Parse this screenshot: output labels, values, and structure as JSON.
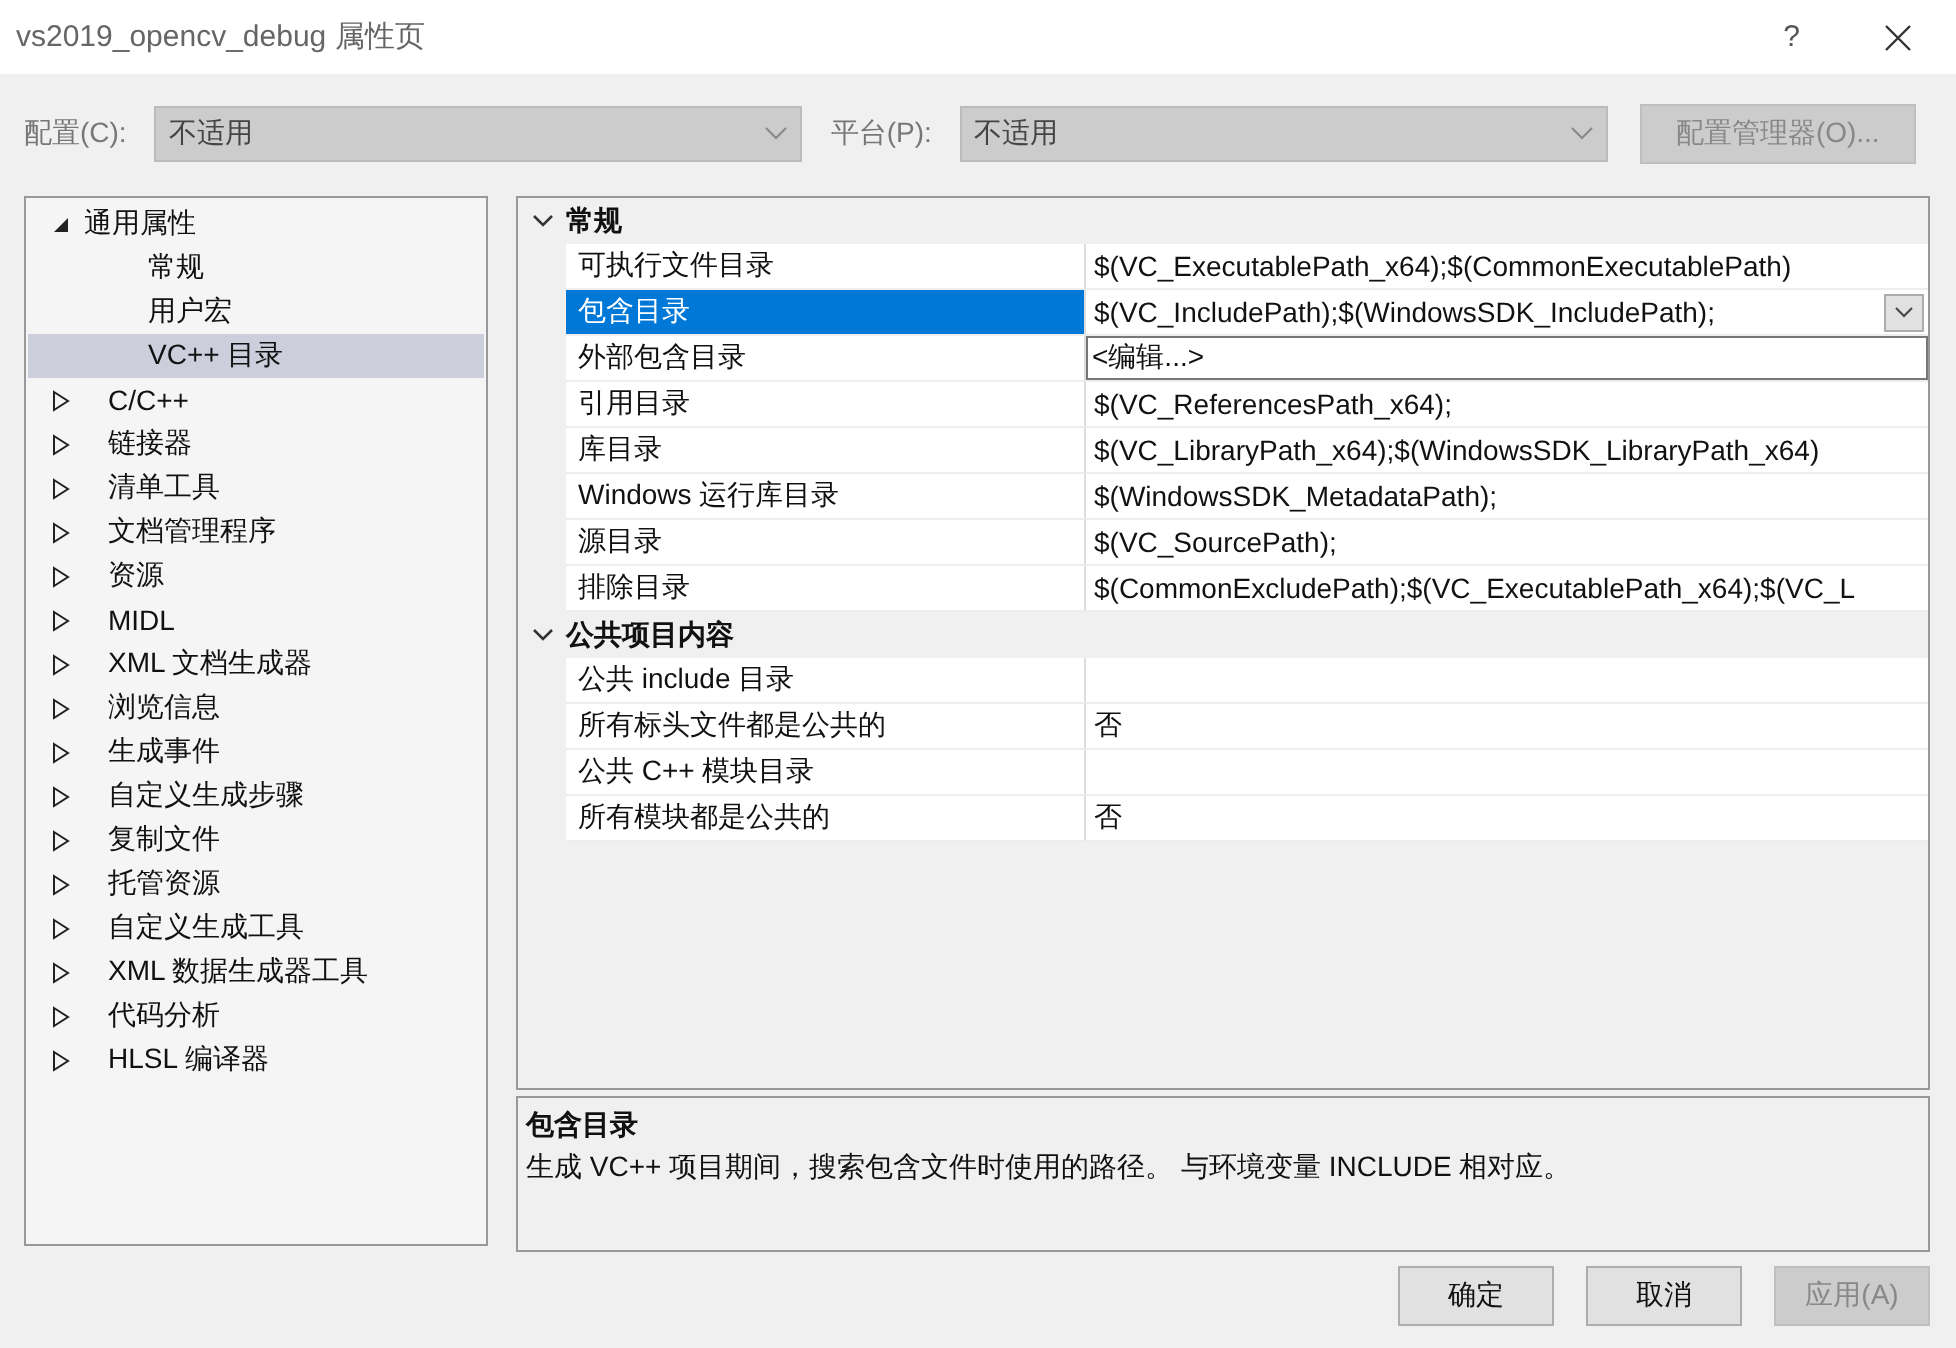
{
  "window": {
    "title": "vs2019_opencv_debug 属性页",
    "help": "?"
  },
  "config": {
    "label": "配置(C):",
    "value": "不适用",
    "disabled": true
  },
  "platform": {
    "label": "平台(P):",
    "value": "不适用",
    "disabled": true
  },
  "config_manager_button": {
    "label": "配置管理器(O)...",
    "disabled": true
  },
  "tree": [
    {
      "label": "通用属性",
      "expanded": true,
      "selected": false,
      "children": [
        {
          "label": "常规",
          "selected": false
        },
        {
          "label": "用户宏",
          "selected": false
        },
        {
          "label": "VC++ 目录",
          "selected": true
        }
      ]
    },
    {
      "label": "C/C++",
      "expanded": false,
      "selected": false
    },
    {
      "label": "链接器",
      "expanded": false,
      "selected": false
    },
    {
      "label": "清单工具",
      "expanded": false,
      "selected": false
    },
    {
      "label": "文档管理程序",
      "expanded": false,
      "selected": false
    },
    {
      "label": "资源",
      "expanded": false,
      "selected": false
    },
    {
      "label": "MIDL",
      "expanded": false,
      "selected": false
    },
    {
      "label": "XML 文档生成器",
      "expanded": false,
      "selected": false
    },
    {
      "label": "浏览信息",
      "expanded": false,
      "selected": false
    },
    {
      "label": "生成事件",
      "expanded": false,
      "selected": false
    },
    {
      "label": "自定义生成步骤",
      "expanded": false,
      "selected": false
    },
    {
      "label": "复制文件",
      "expanded": false,
      "selected": false
    },
    {
      "label": "托管资源",
      "expanded": false,
      "selected": false
    },
    {
      "label": "自定义生成工具",
      "expanded": false,
      "selected": false
    },
    {
      "label": "XML 数据生成器工具",
      "expanded": false,
      "selected": false
    },
    {
      "label": "代码分析",
      "expanded": false,
      "selected": false
    },
    {
      "label": "HLSL 编译器",
      "expanded": false,
      "selected": false
    }
  ],
  "sections": [
    {
      "title": "常规",
      "expanded": true,
      "rows": [
        {
          "name": "可执行文件目录",
          "value": "$(VC_ExecutablePath_x64);$(CommonExecutablePath)",
          "selected": false
        },
        {
          "name": "包含目录",
          "value": "$(VC_IncludePath);$(WindowsSDK_IncludePath);",
          "selected": true,
          "options": [
            "<编辑...>"
          ]
        },
        {
          "name": "外部包含目录",
          "selected": false
        },
        {
          "name": "引用目录",
          "value": "$(VC_ReferencesPath_x64);",
          "selected": false
        },
        {
          "name": "库目录",
          "value": "$(VC_LibraryPath_x64);$(WindowsSDK_LibraryPath_x64)",
          "selected": false
        },
        {
          "name": "Windows 运行库目录",
          "value": "$(WindowsSDK_MetadataPath);",
          "selected": false
        },
        {
          "name": "源目录",
          "value": "$(VC_SourcePath);",
          "selected": false
        },
        {
          "name": "排除目录",
          "value": "$(CommonExcludePath);$(VC_ExecutablePath_x64);$(VC_L",
          "selected": false
        }
      ]
    },
    {
      "title": "公共项目内容",
      "expanded": true,
      "rows": [
        {
          "name": "公共 include 目录",
          "selected": false
        },
        {
          "name": "所有标头文件都是公共的",
          "value": "否",
          "selected": false
        },
        {
          "name": "公共 C++ 模块目录",
          "selected": false
        },
        {
          "name": "所有模块都是公共的",
          "value": "否",
          "selected": false
        }
      ]
    }
  ],
  "description": {
    "title": "包含目录",
    "text": "生成 VC++ 项目期间，搜索包含文件时使用的路径。 与环境变量 INCLUDE 相对应。"
  },
  "buttons": [
    {
      "label": "确定",
      "disabled": false
    },
    {
      "label": "取消",
      "disabled": false
    },
    {
      "label": "应用(A)",
      "disabled": true
    }
  ]
}
